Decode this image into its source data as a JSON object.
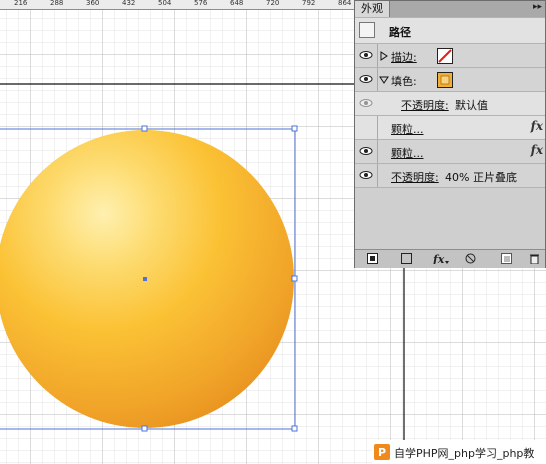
{
  "ruler": {
    "labels": [
      "216",
      "288",
      "360",
      "432",
      "504",
      "576",
      "648",
      "720",
      "792",
      "864"
    ]
  },
  "panel": {
    "tab_title": "外观",
    "menu_glyph": "▸▸",
    "object_label": "路径",
    "rows": {
      "stroke_label": "描边:",
      "fill_label": "填色:",
      "opacity_link": "不透明度:",
      "opacity_value": "默认值",
      "grain1_label": "颗粒...",
      "grain2_label": "颗粒...",
      "opacity2_link": "不透明度:",
      "opacity2_value": "40% 正片叠底",
      "fx_glyph": "fx"
    }
  },
  "colors": {
    "orb_center": "#fff0b0",
    "orb_mid": "#fbc235",
    "orb_edge": "#e8931f",
    "selection": "#4f73d6",
    "grid_minor": "#e3e3e3",
    "grid_major": "#b8b8b8",
    "link": "#1c2fb5"
  },
  "watermark": {
    "text": "自学PHP网_php学习_php教"
  }
}
